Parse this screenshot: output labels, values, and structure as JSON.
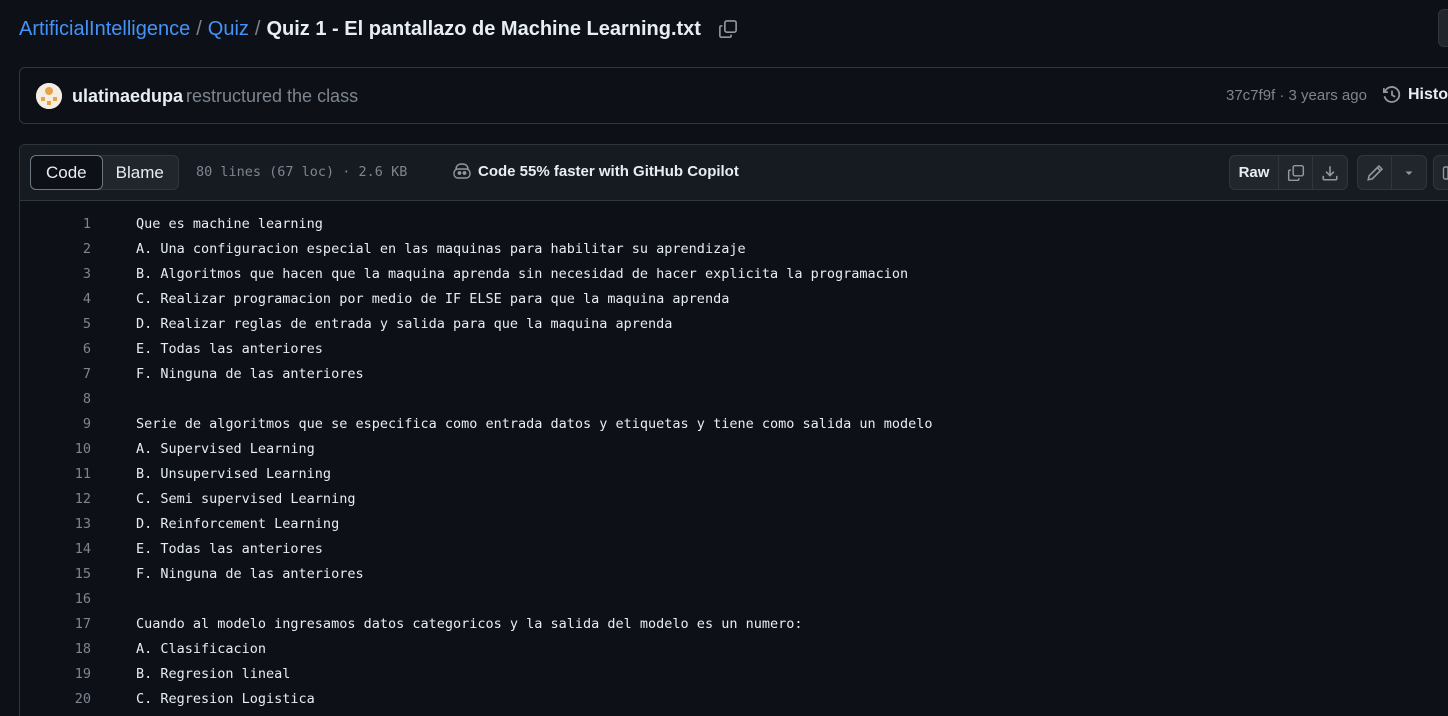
{
  "breadcrumb": {
    "repo": "ArtificialIntelligence",
    "folder": "Quiz",
    "file": "Quiz 1 - El pantallazo de Machine Learning.txt",
    "separator": "/"
  },
  "commit": {
    "author": "ulatinaedupa",
    "message": "restructured the class",
    "meta": "37c7f9f · 3 years ago",
    "history_label": "History"
  },
  "file_header": {
    "tabs": [
      "Code",
      "Blame"
    ],
    "active_tab": "Code",
    "info": "80 lines (67 loc) · 2.6 KB",
    "copilot": "Code 55% faster with GitHub Copilot",
    "raw_label": "Raw"
  },
  "icons": {
    "copy": "copy-icon",
    "download": "download-icon",
    "edit": "pencil-icon",
    "history": "history-icon",
    "copilot": "copilot-icon",
    "dropdown": "triangle-down-icon"
  },
  "colors": {
    "link": "#4493f8",
    "background": "#0d1117",
    "header_bg": "#161b22",
    "border": "#30363d",
    "muted": "#7d8590",
    "text": "#e6edf3"
  },
  "lines": [
    {
      "n": "1",
      "t": "Que es machine learning"
    },
    {
      "n": "2",
      "t": "A. Una configuracion especial en las maquinas para habilitar su aprendizaje"
    },
    {
      "n": "3",
      "t": "B. Algoritmos que hacen que la maquina aprenda sin necesidad de hacer explicita la programacion"
    },
    {
      "n": "4",
      "t": "C. Realizar programacion por medio de IF ELSE para que la maquina aprenda"
    },
    {
      "n": "5",
      "t": "D. Realizar reglas de entrada y salida para que la maquina aprenda"
    },
    {
      "n": "6",
      "t": "E. Todas las anteriores"
    },
    {
      "n": "7",
      "t": "F. Ninguna de las anteriores"
    },
    {
      "n": "8",
      "t": ""
    },
    {
      "n": "9",
      "t": "Serie de algoritmos que se especifica como entrada datos y etiquetas y tiene como salida un modelo"
    },
    {
      "n": "10",
      "t": "A. Supervised Learning"
    },
    {
      "n": "11",
      "t": "B. Unsupervised Learning"
    },
    {
      "n": "12",
      "t": "C. Semi supervised Learning"
    },
    {
      "n": "13",
      "t": "D. Reinforcement Learning"
    },
    {
      "n": "14",
      "t": "E. Todas las anteriores"
    },
    {
      "n": "15",
      "t": "F. Ninguna de las anteriores"
    },
    {
      "n": "16",
      "t": ""
    },
    {
      "n": "17",
      "t": "Cuando al modelo ingresamos datos categoricos y la salida del modelo es un numero:"
    },
    {
      "n": "18",
      "t": "A. Clasificacion"
    },
    {
      "n": "19",
      "t": "B. Regresion lineal"
    },
    {
      "n": "20",
      "t": "C. Regresion Logistica"
    }
  ]
}
